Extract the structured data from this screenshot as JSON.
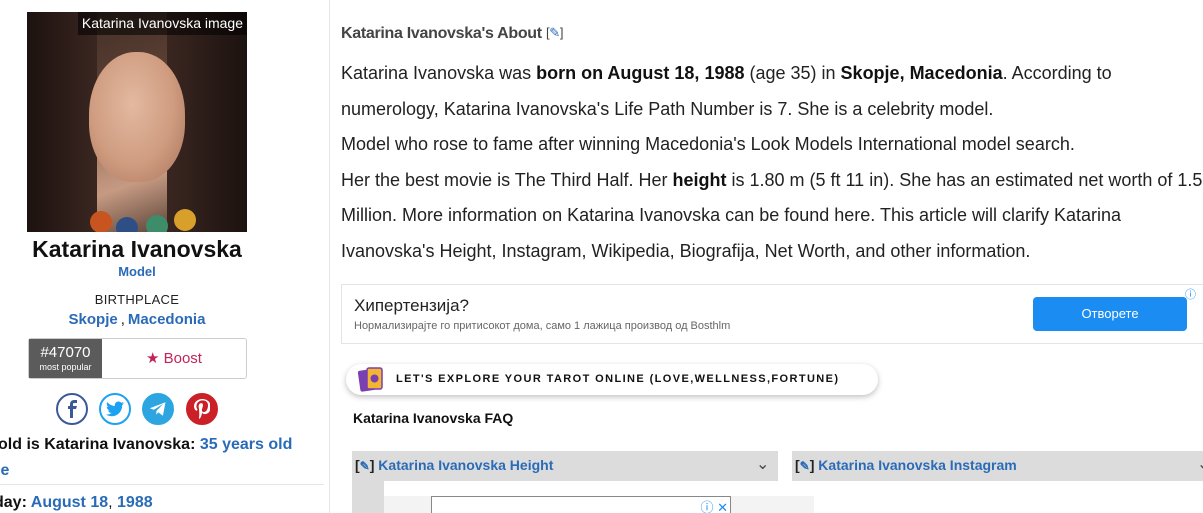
{
  "profile": {
    "photo_caption": "Katarina Ivanovska image",
    "name": "Katarina Ivanovska",
    "profession": "Model",
    "birthplace_label": "BIRTHPLACE",
    "birthplace_city": "Skopje",
    "birthplace_sep": ",",
    "birthplace_country": "Macedonia",
    "rank": "#47070",
    "rank_sub": "most popular",
    "boost_label": "★ Boost",
    "age_question": "old is Katarina Ivanovska:",
    "age_value": "35 years old",
    "age_tail": "le",
    "birthday_label": "day:",
    "birthday_date": "August 18",
    "birthday_comma": ",",
    "birthday_year": "1988"
  },
  "social": {
    "facebook": "facebook-icon",
    "twitter": "twitter-icon",
    "telegram": "telegram-icon",
    "pinterest": "pinterest-icon"
  },
  "about": {
    "title": "Katarina Ivanovska's About",
    "edit_open": "[",
    "edit_glyph": "✎",
    "edit_close": "]",
    "p1_a": "Katarina Ivanovska was ",
    "p1_b": "born on August 18, 1988",
    "p1_c": " (age 35) in ",
    "p1_d": "Skopje, Macedonia",
    "p1_e": ". According to numerology, Katarina Ivanovska's Life Path Number is 7. She is a celebrity model.",
    "p2": "Model who rose to fame after winning Macedonia's Look Models International model search.",
    "p3_a": "Her the best movie is The Third Half. Her ",
    "p3_b": "height",
    "p3_c": " is 1.80 m (5 ft 11 in). She has an estimated net worth of 1.5 Million. More information on Katarina Ivanovska can be found here. This article will clarify Katarina Ivanovska's Height, Instagram, Wikipedia, Biografija, Net Worth, and other information."
  },
  "ad": {
    "title": "Хипертензија?",
    "subtitle": "Нормализирајте го притисокот дома, само 1 лажица производ од Bosthlm",
    "button": "Отворете",
    "info": "ⓘ"
  },
  "tarot": {
    "text": "LET'S EXPLORE YOUR TAROT ONLINE (LOVE,WELLNESS,FORTUNE)"
  },
  "faq": {
    "title": "Katarina Ivanovska FAQ",
    "items": [
      {
        "label": "Katarina Ivanovska Height"
      },
      {
        "label": "Katarina Ivanovska Instagram"
      }
    ],
    "inner_ad_icons": "ⓘ ✕"
  },
  "colors": {
    "link": "#2a6bb8",
    "boost": "#c2245a",
    "ad_button": "#1a8cf2",
    "facebook": "#3b5998",
    "twitter": "#1da1f2",
    "telegram": "#2ca5e0",
    "pinterest": "#cb2027"
  }
}
